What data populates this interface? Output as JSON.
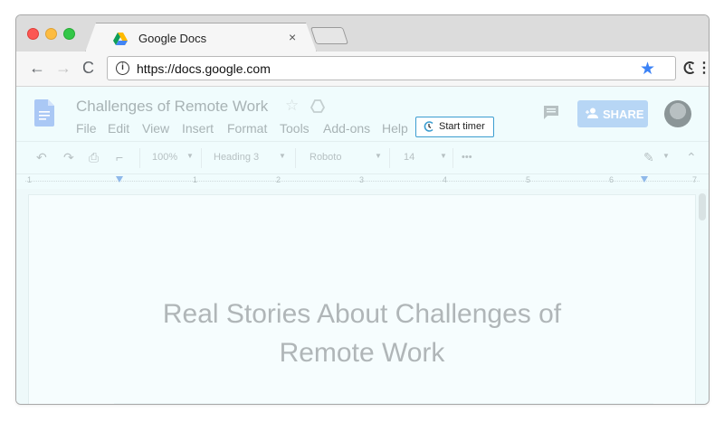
{
  "browser": {
    "tab_title": "Google Docs",
    "tab_close": "×",
    "url": "https://docs.google.com",
    "info_glyph": "i",
    "star_glyph": "★",
    "menu_glyph": "⋮",
    "nav": {
      "back": "←",
      "forward": "→",
      "reload": "C"
    }
  },
  "docs": {
    "title": "Challenges of Remote Work",
    "title_star": "☆",
    "menus": [
      "File",
      "Edit",
      "View",
      "Insert",
      "Format",
      "Tools",
      "Add-ons",
      "Help"
    ],
    "start_timer": "Start timer",
    "share_label": "SHARE"
  },
  "toolbar": {
    "zoom": "100%",
    "style": "Heading 3",
    "font": "Roboto",
    "size": "14",
    "more": "•••"
  },
  "ruler": {
    "numbers": [
      "1",
      "1",
      "2",
      "3",
      "4",
      "5",
      "6",
      "7"
    ]
  },
  "document": {
    "heading_line1": "Real Stories About Challenges of",
    "heading_line2": "Remote Work"
  },
  "colors": {
    "accent": "#3c9dd0",
    "star": "#3b82f6",
    "share_bg": "#b7d6f5"
  }
}
